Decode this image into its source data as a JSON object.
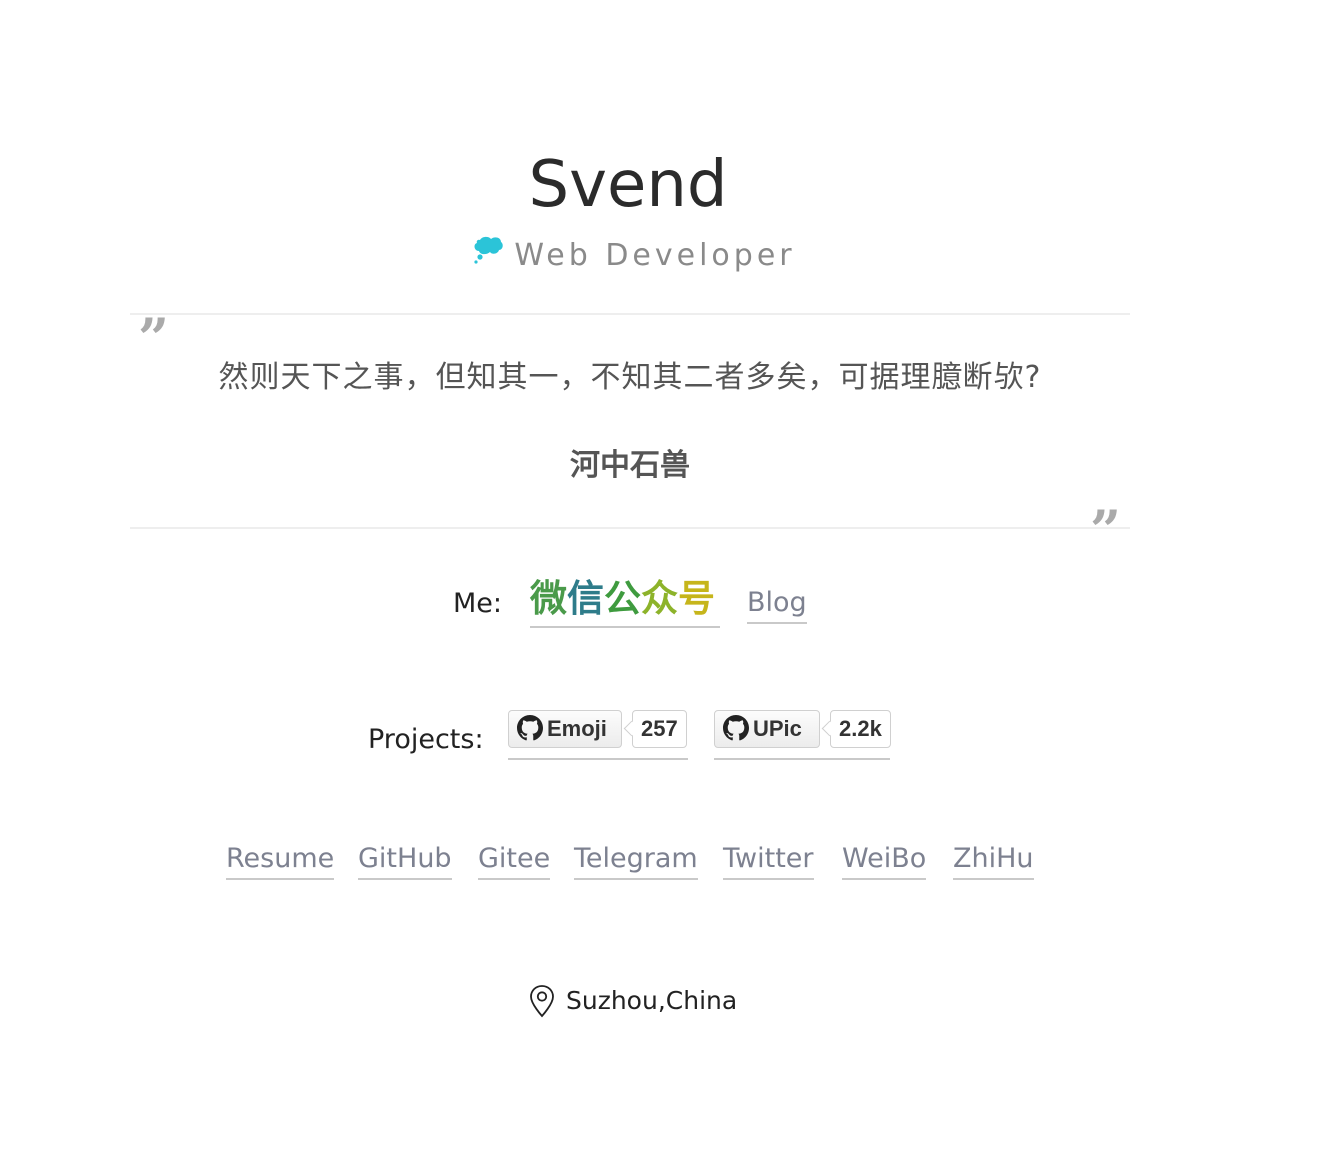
{
  "header": {
    "name": "Svend",
    "subtitle": "Web Developer",
    "subtitle_icon": "thought-bubble-icon",
    "bubble_color": "#2bc4d8"
  },
  "quote": {
    "text": "然则天下之事，但知其一，不知其二者多矣，可据理臆断欤?",
    "author": "河中石兽",
    "open_mark": "”",
    "close_mark": "”"
  },
  "me": {
    "label": "Me:",
    "wechat_chars": [
      "微",
      "信",
      "公",
      "众",
      "号"
    ],
    "wechat_colors": [
      "#4a9a4a",
      "#2e7c8a",
      "#3f9b3f",
      "#8db32a",
      "#c6b51b"
    ],
    "blog_label": "Blog"
  },
  "projects": {
    "label": "Projects:",
    "items": [
      {
        "name": "Emoji",
        "count": "257",
        "icon": "github-icon"
      },
      {
        "name": "UPic",
        "count": "2.2k",
        "icon": "github-icon"
      }
    ]
  },
  "links": [
    {
      "label": "Resume"
    },
    {
      "label": "GitHub"
    },
    {
      "label": "Gitee"
    },
    {
      "label": "Telegram"
    },
    {
      "label": "Twitter"
    },
    {
      "label": "WeiBo"
    },
    {
      "label": "ZhiHu"
    }
  ],
  "location": {
    "icon": "map-pin-icon",
    "text": "Suzhou,China"
  }
}
